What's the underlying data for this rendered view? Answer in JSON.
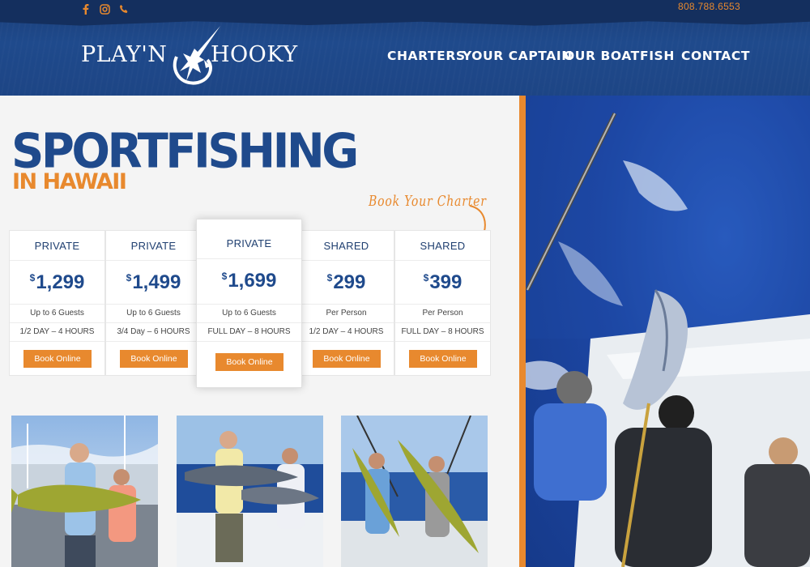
{
  "header": {
    "phone": "808.788.6553",
    "social_icons": [
      "facebook-icon",
      "instagram-icon",
      "phone-icon"
    ],
    "logo_left": "PLAY'N",
    "logo_right": "HOOKY",
    "nav": [
      "CHARTERS",
      "YOUR CAPTAIN",
      "OUR BOAT",
      "FISH",
      "CONTACT"
    ]
  },
  "colors": {
    "navy": "#1f4a8c",
    "accent": "#e8892e"
  },
  "hero": {
    "title": "SPORTFISHING",
    "subtitle": "IN HAWAII",
    "book_charter": "Book Your Charter"
  },
  "pricing": [
    {
      "type": "PRIVATE",
      "currency": "$",
      "price": "1,299",
      "guests": "Up to 6 Guests",
      "duration": "1/2 DAY – 4 HOURS",
      "button": "Book Online"
    },
    {
      "type": "PRIVATE",
      "currency": "$",
      "price": "1,499",
      "guests": "Up to 6 Guests",
      "duration": "3/4 Day – 6 HOURS",
      "button": "Book Online"
    },
    {
      "type": "PRIVATE",
      "currency": "$",
      "price": "1,699",
      "guests": "Up to 6 Guests",
      "duration": "FULL DAY – 8 HOURS",
      "button": "Book Online"
    },
    {
      "type": "SHARED",
      "currency": "$",
      "price": "299",
      "guests": "Per Person",
      "duration": "1/2 DAY – 4 HOURS",
      "button": "Book Online"
    },
    {
      "type": "SHARED",
      "currency": "$",
      "price": "399",
      "guests": "Per Person",
      "duration": "FULL DAY – 8 HOURS",
      "button": "Book Online"
    }
  ]
}
